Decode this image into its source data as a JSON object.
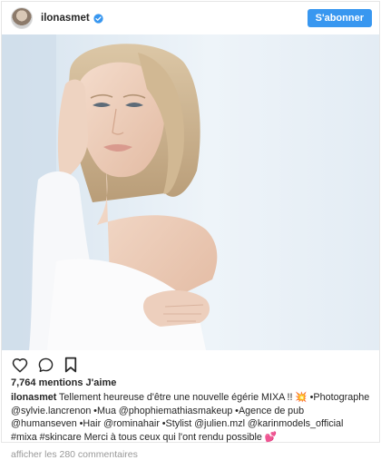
{
  "header": {
    "username": "ilonasmet",
    "follow_label": "S'abonner",
    "accent_color": "#3897f0"
  },
  "post": {
    "image_alt_icon": "portrait-photo"
  },
  "actions": {
    "icons": [
      "heart-icon",
      "comment-icon",
      "bookmark-icon"
    ]
  },
  "likes": {
    "text": "7,764 mentions J'aime"
  },
  "caption": {
    "username": "ilonasmet",
    "text": "Tellement heureuse d'être une nouvelle égérie MIXA !! 💥 •Photographe @sylvie.lancrenon •Mua @phophiemathiasmakeup •Agence de pub @humanseven •Hair @rominahair •Stylist @julien.mzl @karinmodels_official #mixa #skincare Merci à tous ceux qui l'ont rendu possible 💕"
  },
  "comments": {
    "label": "afficher les 280 commentaires"
  }
}
